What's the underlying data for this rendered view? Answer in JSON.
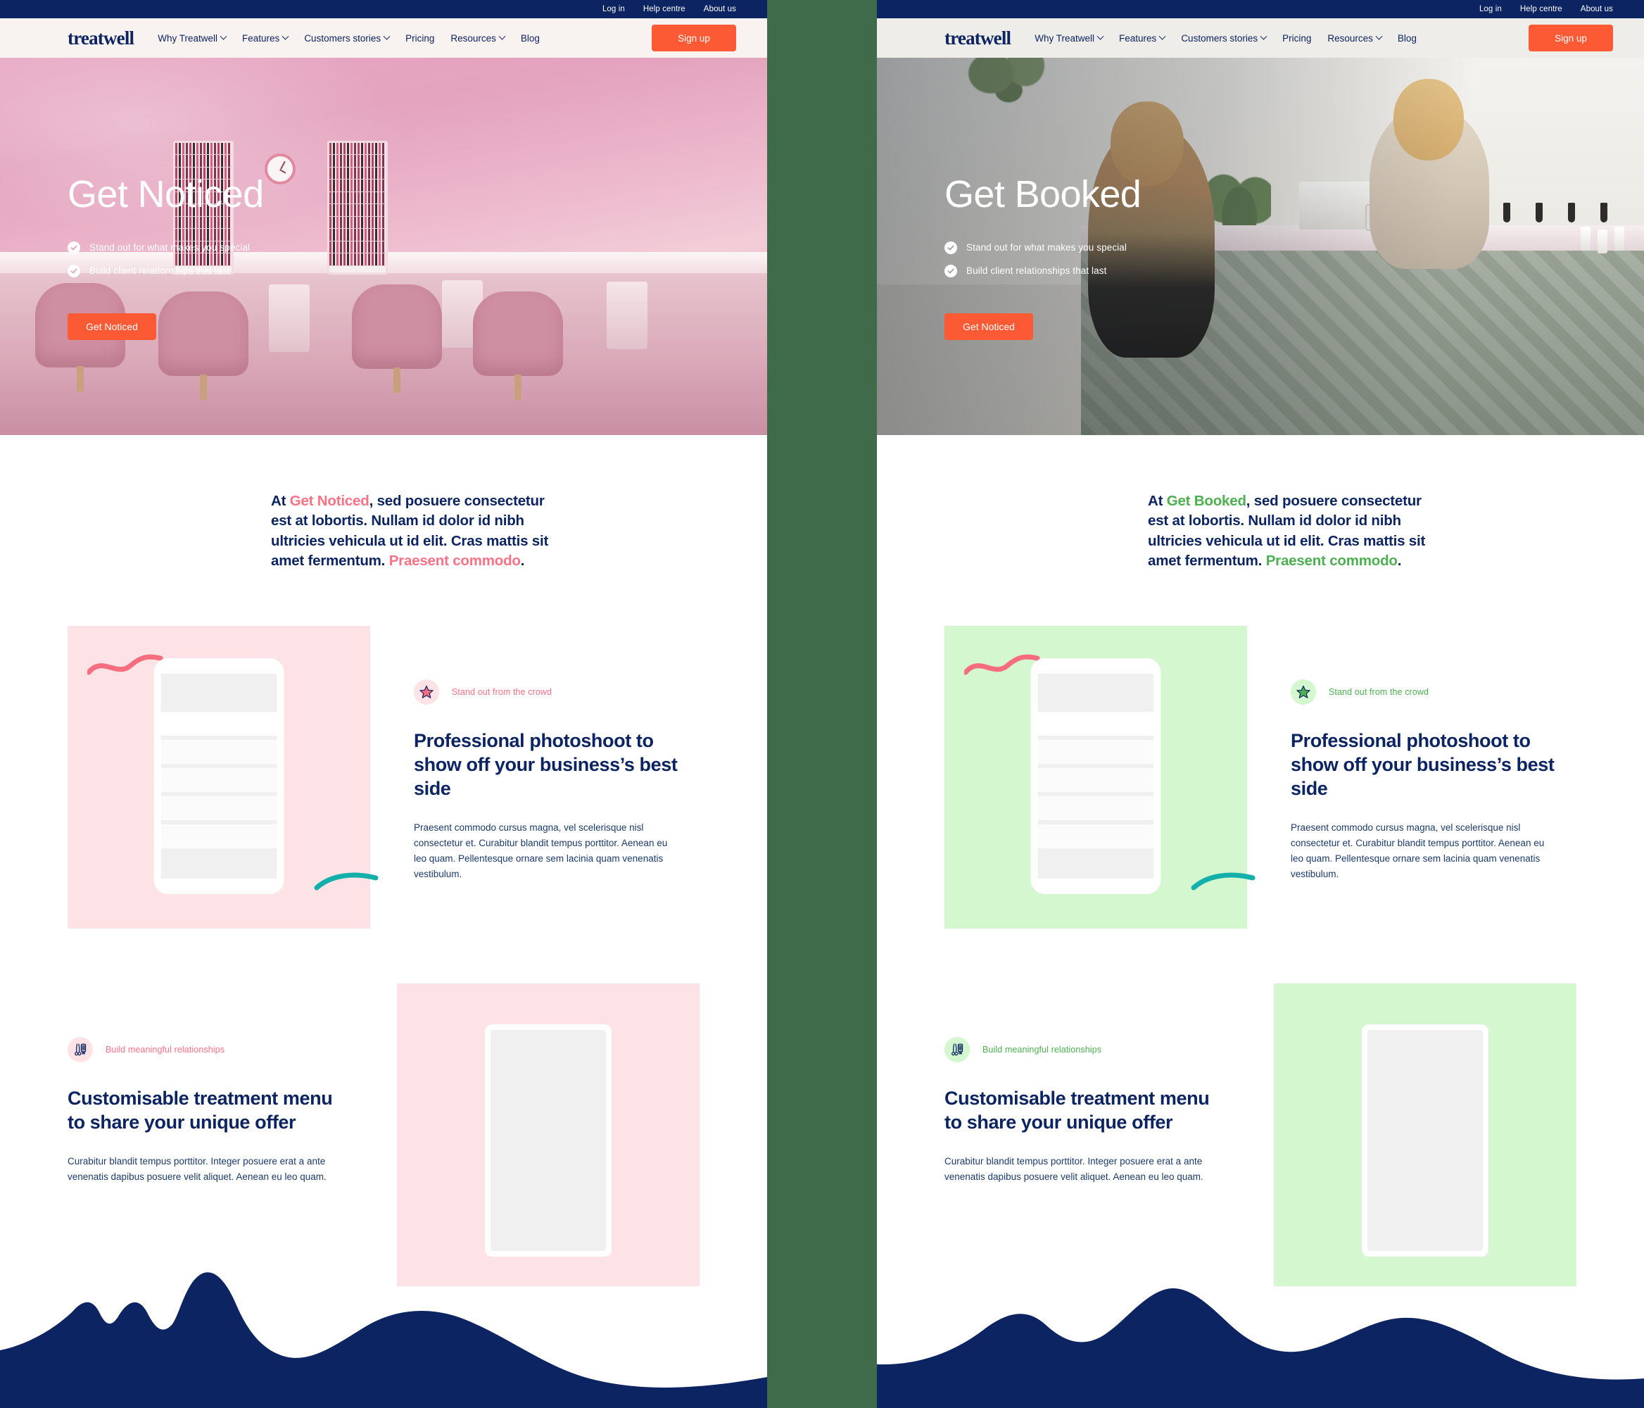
{
  "utility_bar": {
    "links": [
      {
        "label": "Log in"
      },
      {
        "label": "Help centre"
      },
      {
        "label": "About us"
      }
    ]
  },
  "nav": {
    "brand": "treatwell",
    "items": [
      {
        "label": "Why Treatwell",
        "has_caret": true
      },
      {
        "label": "Features",
        "has_caret": true
      },
      {
        "label": "Customers stories",
        "has_caret": true
      },
      {
        "label": "Pricing",
        "has_caret": false
      },
      {
        "label": "Resources",
        "has_caret": true
      },
      {
        "label": "Blog",
        "has_caret": false
      }
    ],
    "signup_label": "Sign up"
  },
  "colors": {
    "navy": "#0c2461",
    "orange": "#fc5a34",
    "pink_accent": "#fb7185",
    "green_accent": "#4caf50",
    "pink_tint": "#fde3e6",
    "green_tint": "#d4f7cf",
    "divider_green": "#3f6b4a",
    "teal_squiggle": "#13b0ab",
    "pink_squiggle": "#f56d7e"
  },
  "variants": {
    "left": {
      "hero": {
        "title": "Get Noticed",
        "bullets": [
          "Stand out for what makes you special",
          "Build client relationships that last"
        ],
        "cta_label": "Get Noticed"
      },
      "intro": {
        "lead": "At ",
        "accent_1": "Get Noticed",
        "middle": ", sed posuere consectetur est at lobortis. Nullam id dolor id nibh ultricies vehicula ut id elit. Cras mattis sit amet fermentum. ",
        "accent_2": "Praesent commodo",
        "tail": "."
      },
      "feature_1": {
        "badge_label": "Stand out from the crowd",
        "badge_icon": "star-icon",
        "heading": "Professional photoshoot to show off your business’s best side",
        "body": "Praesent commodo cursus magna, vel scelerisque nisl consectetur et. Curabitur blandit tempus porttitor. Aenean eu leo quam. Pellentesque ornare sem lacinia quam venenatis vestibulum."
      },
      "feature_2": {
        "badge_label": "Build meaningful relationships",
        "badge_icon": "scissors-comb-icon",
        "heading": "Customisable treatment menu to share your unique offer",
        "body": "Curabitur blandit tempus porttitor. Integer posuere erat a ante venenatis dapibus posuere velit aliquet. Aenean eu leo quam."
      }
    },
    "right": {
      "hero": {
        "title": "Get Booked",
        "bullets": [
          "Stand out for what makes you special",
          "Build client relationships that last"
        ],
        "cta_label": "Get Noticed"
      },
      "intro": {
        "lead": "At ",
        "accent_1": "Get Booked",
        "middle": ", sed posuere consectetur est at lobortis. Nullam id dolor id nibh ultricies vehicula ut id elit. Cras mattis sit amet fermentum. ",
        "accent_2": "Praesent commodo",
        "tail": "."
      },
      "feature_1": {
        "badge_label": "Stand out from the crowd",
        "badge_icon": "star-icon",
        "heading": "Professional photoshoot to show off your business’s best side",
        "body": "Praesent commodo cursus magna, vel scelerisque nisl consectetur et. Curabitur blandit tempus porttitor. Aenean eu leo quam. Pellentesque ornare sem lacinia quam venenatis vestibulum."
      },
      "feature_2": {
        "badge_label": "Build meaningful relationships",
        "badge_icon": "scissors-comb-icon",
        "heading": "Customisable treatment menu to share your unique offer",
        "body": "Curabitur blandit tempus porttitor. Integer posuere erat a ante venenatis dapibus posuere velit aliquet. Aenean eu leo quam."
      }
    }
  }
}
